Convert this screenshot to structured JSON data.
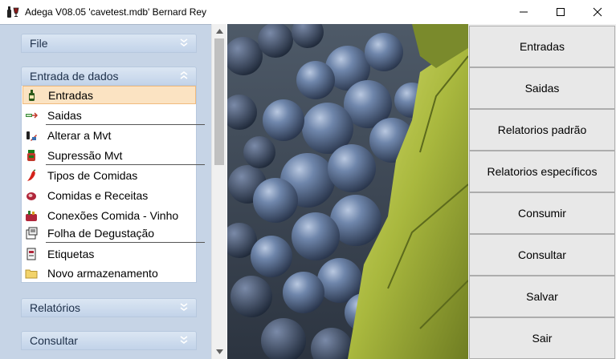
{
  "window": {
    "title": "Adega V08.05  'cavetest.mdb'   Bernard Rey",
    "app_icon": "wine-bottle-glass-icon",
    "controls": [
      "minimize-icon",
      "maximize-icon",
      "close-icon"
    ]
  },
  "sidebar": {
    "groups": [
      {
        "label": "File",
        "state": "collapsed",
        "icon": "double-chevron-down-icon"
      },
      {
        "label": "Entrada de dados",
        "state": "expanded",
        "icon": "double-chevron-up-icon"
      },
      {
        "label": "Relatórios",
        "state": "collapsed",
        "icon": "double-chevron-down-icon"
      },
      {
        "label": "Consultar",
        "state": "collapsed",
        "icon": "double-chevron-down-icon"
      }
    ],
    "items": [
      {
        "label": "Entradas",
        "icon": "wine-bottle-icon",
        "selected": true
      },
      {
        "label": "Saidas",
        "icon": "arrow-out-icon",
        "selected": false
      },
      {
        "label": "Alterar a Mvt",
        "icon": "edit-bottle-icon",
        "selected": false
      },
      {
        "label": "Supressão Mvt",
        "icon": "delete-bottle-icon",
        "selected": false
      },
      {
        "label": "Tipos de Comidas",
        "icon": "chili-pepper-icon",
        "selected": false
      },
      {
        "label": "Comidas e Receitas",
        "icon": "meat-icon",
        "selected": false
      },
      {
        "label": "Conexões Comida - Vinho",
        "icon": "food-wine-icon",
        "selected": false
      },
      {
        "label": "Folha de Degustação",
        "icon": "tasting-sheet-icon",
        "selected": false
      },
      {
        "label": "Etiquetas",
        "icon": "label-icon",
        "selected": false
      },
      {
        "label": "Novo armazenamento",
        "icon": "folder-icon",
        "selected": false
      }
    ]
  },
  "image": {
    "subject": "grape-cluster-photo",
    "colors": {
      "grapes": "#4b6486",
      "leaf": "#a8b640",
      "background": "#3a4350"
    }
  },
  "buttons": [
    "Entradas",
    "Saidas",
    "Relatorios padrão",
    "Relatorios específicos",
    "Consumir",
    "Consultar",
    "Salvar",
    "Sair"
  ],
  "colors": {
    "sidebar_bg": "#c6d4e6",
    "selected_bg": "#fbe3c2",
    "button_bg": "#e8e8e8"
  }
}
